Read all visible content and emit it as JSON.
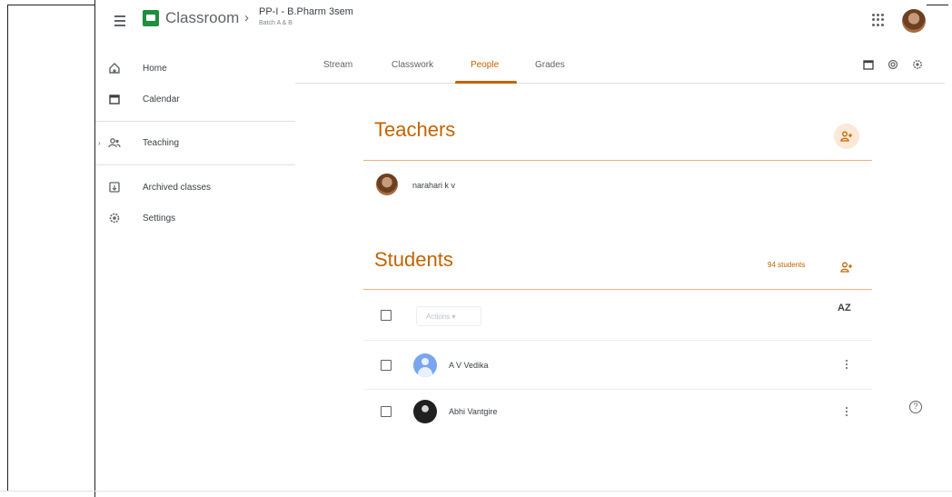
{
  "header": {
    "brand": "Classroom",
    "separator": "›",
    "class_title": "PP-I - B.Pharm 3sem",
    "class_subtitle": "Batch A & B"
  },
  "sidebar": {
    "items": [
      {
        "label": "Home",
        "icon": "home-icon"
      },
      {
        "label": "Calendar",
        "icon": "calendar-icon"
      },
      {
        "label": "Teaching",
        "icon": "people-icon"
      },
      {
        "label": "Archived classes",
        "icon": "archive-icon"
      },
      {
        "label": "Settings",
        "icon": "gear-icon"
      }
    ]
  },
  "tabs": [
    {
      "label": "Stream"
    },
    {
      "label": "Classwork"
    },
    {
      "label": "People",
      "active": true
    },
    {
      "label": "Grades"
    }
  ],
  "teachers": {
    "title": "Teachers",
    "list": [
      {
        "name": "narahari k v"
      }
    ]
  },
  "students": {
    "title": "Students",
    "count": "94 students",
    "actions_label": "Actions ▾",
    "sort_label": "AZ",
    "list": [
      {
        "name": "A V Vedika"
      },
      {
        "name": "Abhi Vantgire"
      }
    ]
  },
  "help": {
    "label": "?"
  },
  "colors": {
    "accent": "#c26401",
    "brand_green": "#1e8e3e",
    "divider": "#e0e0e0"
  }
}
